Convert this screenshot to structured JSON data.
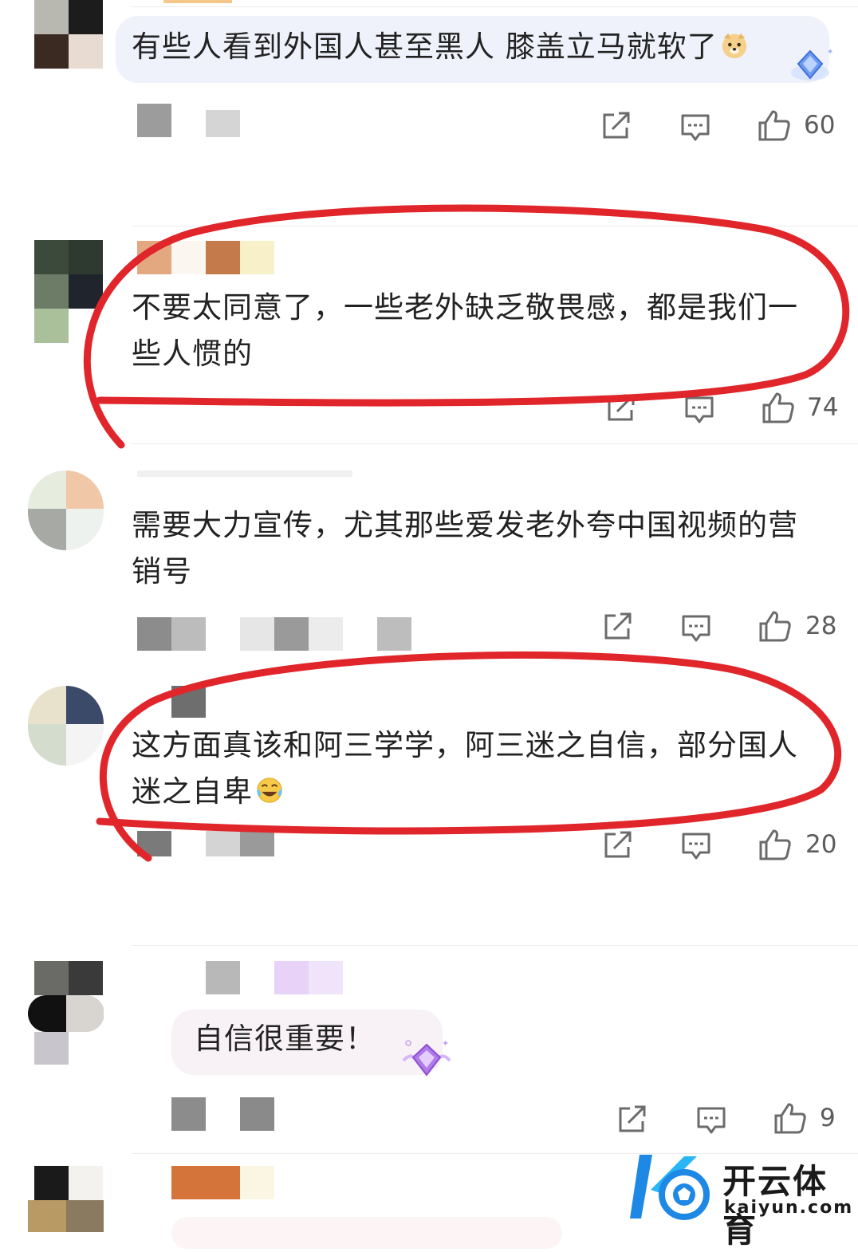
{
  "comments": [
    {
      "text_lines": [
        "有些人看到外国人甚至黑人 膝盖立马就软了"
      ],
      "emoji": "doge-emoji",
      "likes": "60",
      "badge": "diamond-badge-blue"
    },
    {
      "text_lines": [
        "不要太同意了，一些老外缺乏敬畏感，都是我们一",
        "些人惯的"
      ],
      "likes": "74"
    },
    {
      "text_lines": [
        "需要大力宣传，尤其那些爱发老外夸中国视频的营",
        "销号"
      ],
      "likes": "28"
    },
    {
      "text_lines": [
        "这方面真该和阿三学学，阿三迷之自信，部分国人",
        "迷之自卑"
      ],
      "emoji": "laugh-cry-emoji",
      "likes": "20"
    },
    {
      "text_lines": [
        "自信很重要！"
      ],
      "likes": "9",
      "badge": "diamond-badge-purple"
    }
  ],
  "watermark": {
    "name": "开云体育",
    "url": "kaiyun.com"
  },
  "colors": {
    "annotation_red": "#e0262b",
    "bubble_blue": "#eef1fb",
    "bubble_pink": "#f7f1f6",
    "icon_gray": "#6b6b6b",
    "watermark_blue": "#1e88e5"
  },
  "icons": [
    "share-icon",
    "comment-icon",
    "thumbs-up-icon"
  ]
}
